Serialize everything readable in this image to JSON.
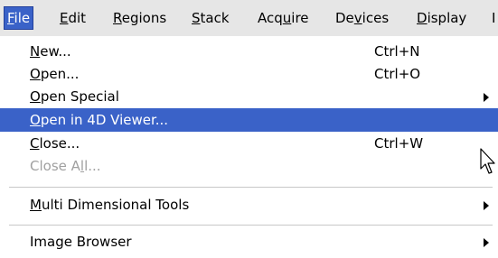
{
  "menubar": {
    "items": [
      {
        "pre": "",
        "u": "F",
        "post": "ile"
      },
      {
        "pre": "",
        "u": "E",
        "post": "dit"
      },
      {
        "pre": "",
        "u": "R",
        "post": "egions"
      },
      {
        "pre": "",
        "u": "S",
        "post": "tack"
      },
      {
        "pre": "Acq",
        "u": "u",
        "post": "ire"
      },
      {
        "pre": "De",
        "u": "v",
        "post": "ices"
      },
      {
        "pre": "",
        "u": "D",
        "post": "isplay"
      },
      {
        "pre": "",
        "u": "",
        "post": "I"
      }
    ]
  },
  "file_menu": {
    "items": [
      {
        "pre": "",
        "u": "N",
        "post": "ew...",
        "shortcut": "Ctrl+N"
      },
      {
        "pre": "",
        "u": "O",
        "post": "pen...",
        "shortcut": "Ctrl+O"
      },
      {
        "pre": "",
        "u": "O",
        "post": "pen Special",
        "shortcut": ""
      },
      {
        "pre": "",
        "u": "O",
        "post": "pen in 4D Viewer...",
        "shortcut": ""
      },
      {
        "pre": "",
        "u": "C",
        "post": "lose...",
        "shortcut": "Ctrl+W"
      },
      {
        "pre": "Close A",
        "u": "l",
        "post": "l...",
        "shortcut": ""
      },
      {
        "pre": "",
        "u": "M",
        "post": "ulti Dimensional Tools",
        "shortcut": ""
      },
      {
        "pre": "Image Browser",
        "u": "",
        "post": "",
        "shortcut": ""
      }
    ]
  },
  "icons": {
    "submenu": "submenu-arrow-icon",
    "cursor": "mouse-pointer-icon"
  },
  "colors": {
    "menubar_bg": "#e6e6e6",
    "highlight": "#3a62c8",
    "disabled_text": "#a0a0a0"
  }
}
